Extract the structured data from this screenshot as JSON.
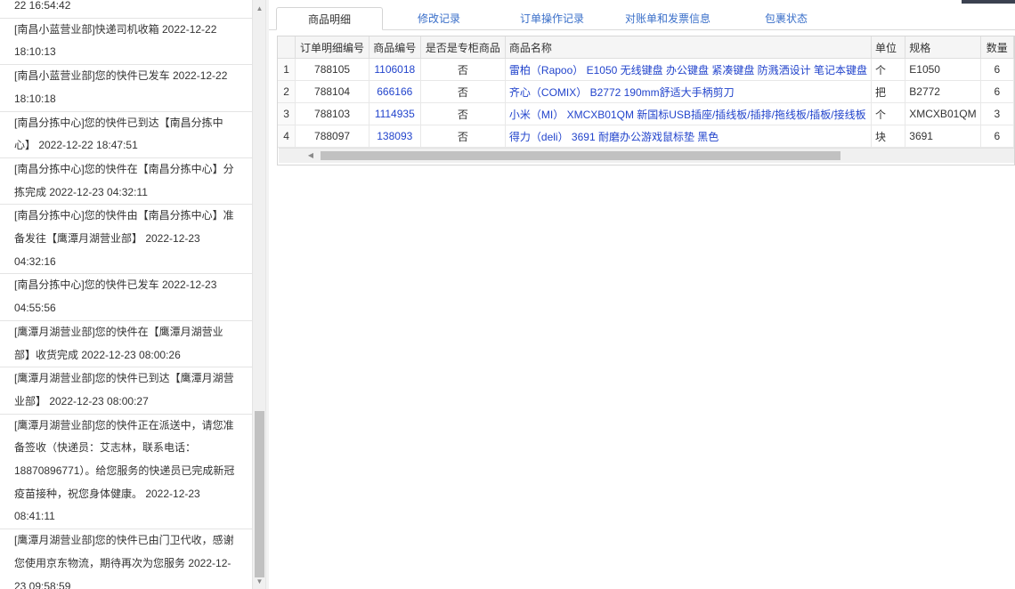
{
  "log": {
    "items": [
      [
        "22 16:54:42"
      ],
      [
        "[南昌小蓝营业部]快递司机收箱 2022-12-22",
        "18:10:13"
      ],
      [
        "[南昌小蓝营业部]您的快件已发车 2022-12-22",
        "18:10:18"
      ],
      [
        "[南昌分拣中心]您的快件已到达【南昌分拣中",
        "心】 2022-12-22 18:47:51"
      ],
      [
        "[南昌分拣中心]您的快件在【南昌分拣中心】分",
        "拣完成 2022-12-23 04:32:11"
      ],
      [
        "[南昌分拣中心]您的快件由【南昌分拣中心】准",
        "备发往【鹰潭月湖营业部】 2022-12-23",
        "04:32:16"
      ],
      [
        "[南昌分拣中心]您的快件已发车 2022-12-23",
        "04:55:56"
      ],
      [
        "[鹰潭月湖营业部]您的快件在【鹰潭月湖营业",
        "部】收货完成 2022-12-23 08:00:26"
      ],
      [
        "[鹰潭月湖营业部]您的快件已到达【鹰潭月湖营",
        "业部】 2022-12-23 08:00:27"
      ],
      [
        "[鹰潭月湖营业部]您的快件正在派送中，请您准",
        "备签收（快递员：艾志林，联系电话：",
        "18870896771）。给您服务的快递员已完成新冠",
        "疫苗接种，祝您身体健康。 2022-12-23",
        "08:41:11"
      ],
      [
        "[鹰潭月湖营业部]您的快件已由门卫代收，感谢",
        "您使用京东物流，期待再次为您服务 2022-12-",
        "23 09:58:59"
      ]
    ]
  },
  "tabs": [
    {
      "label": "商品明细",
      "active": true
    },
    {
      "label": "修改记录",
      "active": false
    },
    {
      "label": "订单操作记录",
      "active": false
    },
    {
      "label": "对账单和发票信息",
      "active": false
    },
    {
      "label": "包裹状态",
      "active": false
    }
  ],
  "grid": {
    "columns": [
      "",
      "订单明细编号",
      "商品编号",
      "是否是专柜商品",
      "商品名称",
      "单位",
      "规格",
      "数量"
    ],
    "rows": [
      {
        "num": "1",
        "detail_id": "788105",
        "sku": "1106018",
        "counter": "否",
        "name": "雷柏（Rapoo） E1050 无线键盘 办公键盘 紧凑键盘 防溅洒设计 笔记本键盘",
        "unit": "个",
        "spec": "E1050",
        "qty": "6"
      },
      {
        "num": "2",
        "detail_id": "788104",
        "sku": "666166",
        "counter": "否",
        "name": "齐心（COMIX） B2772 190mm舒适大手柄剪刀",
        "unit": "把",
        "spec": "B2772",
        "qty": "6"
      },
      {
        "num": "3",
        "detail_id": "788103",
        "sku": "1114935",
        "counter": "否",
        "name": "小米（MI） XMCXB01QM 新国标USB插座/插线板/插排/拖线板/插板/接线板",
        "unit": "个",
        "spec": "XMCXB01QM",
        "qty": "3"
      },
      {
        "num": "4",
        "detail_id": "788097",
        "sku": "138093",
        "counter": "否",
        "name": "得力（deli） 3691 耐磨办公游戏鼠标垫 黑色",
        "unit": "块",
        "spec": "3691",
        "qty": "6"
      }
    ]
  }
}
